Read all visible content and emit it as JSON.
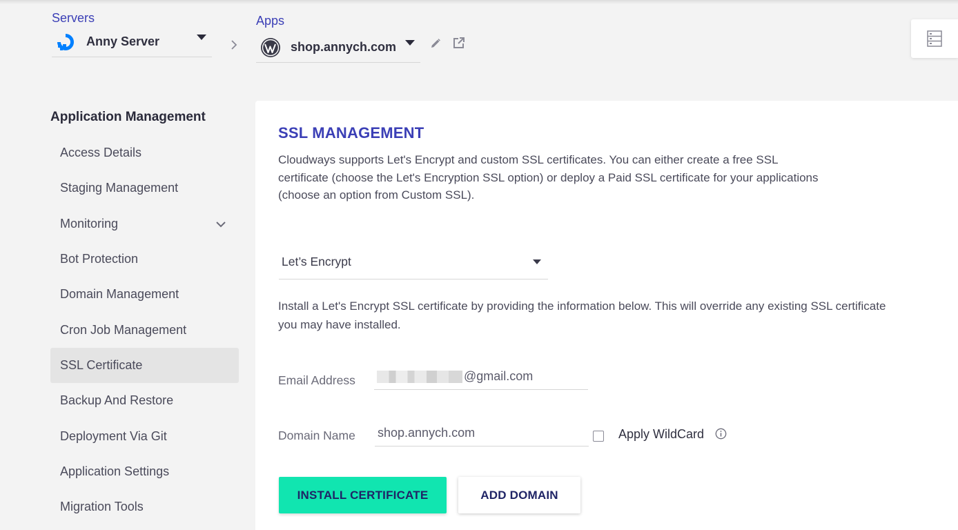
{
  "header": {
    "servers_label": "Servers",
    "server_name": "Anny Server",
    "apps_label": "Apps",
    "app_name": "shop.annych.com"
  },
  "sidebar": {
    "title": "Application Management",
    "items": [
      {
        "label": "Access Details"
      },
      {
        "label": "Staging Management"
      },
      {
        "label": "Monitoring",
        "expandable": true
      },
      {
        "label": "Bot Protection"
      },
      {
        "label": "Domain Management"
      },
      {
        "label": "Cron Job Management"
      },
      {
        "label": "SSL Certificate",
        "active": true
      },
      {
        "label": "Backup And Restore"
      },
      {
        "label": "Deployment Via Git"
      },
      {
        "label": "Application Settings"
      },
      {
        "label": "Migration Tools"
      }
    ]
  },
  "ssl": {
    "title": "SSL MANAGEMENT",
    "description": "Cloudways supports Let's Encrypt and custom SSL certificates. You can either create a free SSL certificate (choose the Let's Encryption SSL option) or deploy a Paid SSL certificate for your applications (choose an option from Custom SSL).",
    "provider_selected": "Let’s Encrypt",
    "install_description": "Install a Let's Encrypt SSL certificate by providing the information below. This will override any existing SSL certificate you may have installed.",
    "email_label": "Email Address",
    "email_value_visible": "@gmail.com",
    "domain_label": "Domain Name",
    "domain_value": "shop.annych.com",
    "wildcard_label": "Apply WildCard",
    "wildcard_checked": false,
    "install_button": "INSTALL CERTIFICATE",
    "add_domain_button": "ADD DOMAIN"
  },
  "icons": {
    "server_provider": "digitalocean-logo-icon",
    "app_platform": "wordpress-logo-icon",
    "edit": "pencil-icon",
    "open_external": "external-link-icon",
    "corner": "server-list-icon",
    "info": "info-icon"
  },
  "colors": {
    "accent": "#3b3fb6",
    "install_button_bg": "#11e5b0",
    "button_text": "#1f2466",
    "active_item_bg": "#e4e4e4",
    "digitalocean_blue": "#0080ff"
  }
}
